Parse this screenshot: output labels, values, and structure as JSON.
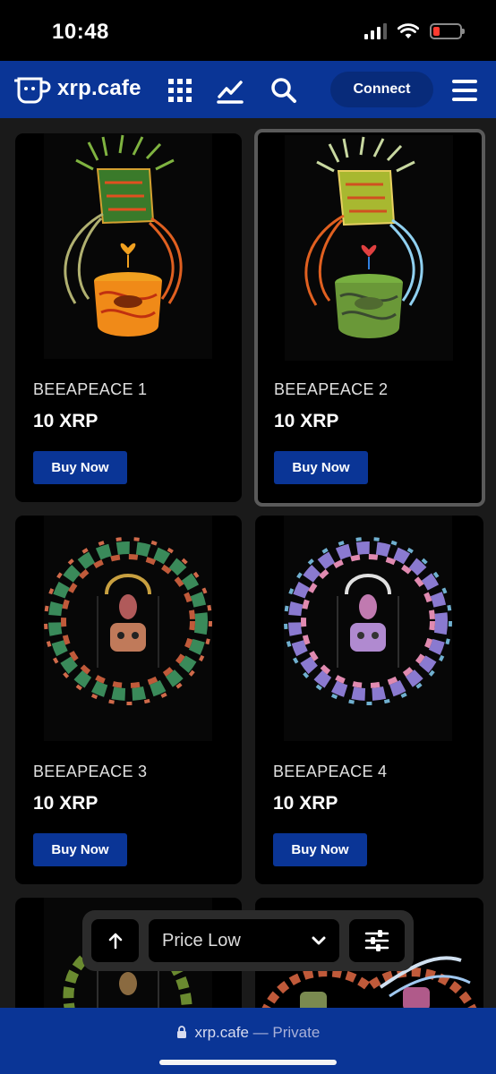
{
  "status": {
    "time": "10:48"
  },
  "brand": {
    "name": "xrp.cafe"
  },
  "nav": {
    "connect_label": "Connect"
  },
  "items": [
    {
      "name": "BEEAPEACE 1",
      "price": "10 XRP",
      "button": "Buy Now"
    },
    {
      "name": "BEEAPEACE 2",
      "price": "10 XRP",
      "button": "Buy Now"
    },
    {
      "name": "BEEAPEACE 3",
      "price": "10 XRP",
      "button": "Buy Now"
    },
    {
      "name": "BEEAPEACE 4",
      "price": "10 XRP",
      "button": "Buy Now"
    }
  ],
  "sort": {
    "selected": "Price Low"
  },
  "browser": {
    "domain": "xrp.cafe",
    "separator": " — ",
    "mode": "Private"
  },
  "colors": {
    "brand": "#0a3596",
    "card": "#000000",
    "page": "#1a1a1a",
    "battery": "#ff3b30"
  }
}
